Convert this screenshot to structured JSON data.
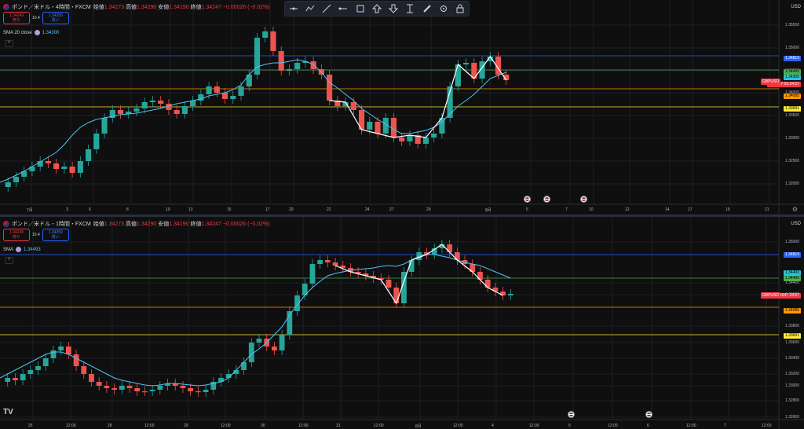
{
  "pane1": {
    "title": "ポンド／米ドル・4時間・FXCM",
    "ohlc": [
      {
        "k": "始値",
        "v": "1.34273"
      },
      {
        "k": "高値",
        "v": "1.34290"
      },
      {
        "k": "安値",
        "v": "1.34190"
      },
      {
        "k": "終値",
        "v": "1.34247"
      },
      {
        "k": "",
        "v": "−0.00026 (−0.02%)"
      }
    ],
    "sell_price": "1.34249",
    "sell_label": "売り",
    "spread": "10.4",
    "buy_price": "1.34359",
    "buy_label": "買い",
    "indicator_name": "SMA 20 close",
    "indicator_value": "1.34300",
    "currency": "USD",
    "price_labels": [
      "1.35500",
      "1.35000",
      "1.34500",
      "1.34000",
      "1.33500",
      "1.33000",
      "1.32500",
      "1.32000"
    ],
    "tags": [
      {
        "text": "1.34819",
        "color": "#2962ff"
      },
      {
        "text": "1.34490",
        "color": "#4caf50"
      },
      {
        "text": "1.34300",
        "color": "#26c6da"
      },
      {
        "text": "1.34247",
        "sub": "03:24:57",
        "color": "#f23645"
      },
      {
        "text": "1.34085",
        "color": "#ff9800"
      },
      {
        "text": "1.33691",
        "color": "#ffeb3b"
      }
    ],
    "symbol_tag": "GBPUSD",
    "x_labels": [
      "7月",
      "3",
      "6",
      "8",
      "10",
      "13",
      "15",
      "17",
      "20",
      "22",
      "24",
      "27",
      "29",
      "8月",
      "5",
      "7",
      "10",
      "12",
      "14",
      "17",
      "19",
      "21"
    ]
  },
  "pane2": {
    "title": "ポンド／米ドル・1時間・FXCM",
    "ohlc": [
      {
        "k": "始値",
        "v": "1.34273"
      },
      {
        "k": "高値",
        "v": "1.34290"
      },
      {
        "k": "安値",
        "v": "1.34190"
      },
      {
        "k": "終値",
        "v": "1.34247"
      },
      {
        "k": "",
        "v": "−0.00026 (−0.02%)"
      }
    ],
    "sell_price": "1.34249",
    "sell_label": "売り",
    "spread": "10.4",
    "buy_price": "1.34359",
    "buy_label": "買い",
    "indicator_name": "SMA",
    "indicator_value": "1.34493",
    "currency": "USD",
    "price_labels": [
      "1.35000",
      "1.34400",
      "1.34000",
      "1.33800",
      "1.33600",
      "1.33400",
      "1.33200",
      "1.33000",
      "1.32800",
      "1.32600"
    ],
    "tags": [
      {
        "text": "1.34819",
        "color": "#2962ff"
      },
      {
        "text": "1.34493",
        "color": "#26c6da"
      },
      {
        "text": "1.34490",
        "color": "#4caf50"
      },
      {
        "text": "1.34247",
        "sub": "24:57",
        "color": "#f23645"
      },
      {
        "text": "1.34085",
        "color": "#ff9800"
      },
      {
        "text": "1.33691",
        "color": "#ffeb3b"
      }
    ],
    "symbol_tag": "GBPUSD",
    "x_labels": [
      "25",
      "12:00",
      "28",
      "12:00",
      "29",
      "12:00",
      "30",
      "12:00",
      "31",
      "12:00",
      "8月",
      "12:00",
      "4",
      "12:00",
      "5",
      "12:00",
      "6",
      "12:00",
      "7",
      "12:00"
    ]
  },
  "toolbar": {
    "tools": [
      "horizontal-ray-icon",
      "polyline-icon",
      "trend-line-icon",
      "ray-icon",
      "rectangle-icon",
      "arrow-up-icon",
      "arrow-down-icon",
      "price-range-icon",
      "brush-icon",
      "settings-icon",
      "lock-icon"
    ]
  },
  "logo": "TV"
}
